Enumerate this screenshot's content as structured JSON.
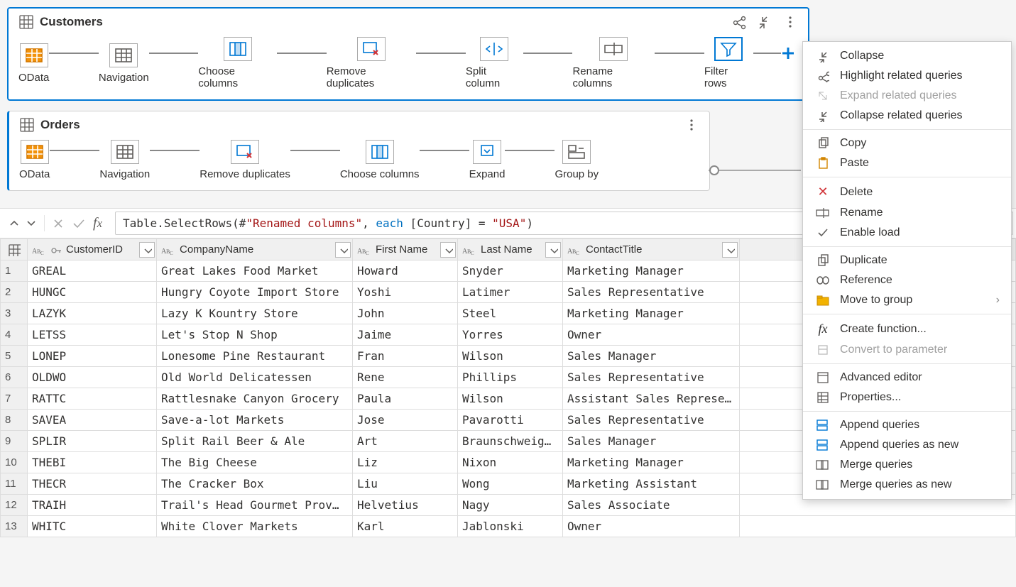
{
  "customers_query": {
    "title": "Customers",
    "steps": [
      "OData",
      "Navigation",
      "Choose columns",
      "Remove duplicates",
      "Split column",
      "Rename columns",
      "Filter rows"
    ]
  },
  "orders_query": {
    "title": "Orders",
    "steps": [
      "OData",
      "Navigation",
      "Remove duplicates",
      "Choose columns",
      "Expand",
      "Group by"
    ]
  },
  "formula": {
    "prefix": "Table.SelectRows(#",
    "step_ref": "\"Renamed columns\"",
    "mid": ", ",
    "each_kw": "each",
    "field": " [Country] = ",
    "value": "\"USA\"",
    "suffix": ")"
  },
  "columns": [
    "CustomerID",
    "CompanyName",
    "First Name",
    "Last Name",
    "ContactTitle"
  ],
  "rows": [
    {
      "n": "1",
      "id": "GREAL",
      "co": "Great Lakes Food Market",
      "fn": "Howard",
      "ln": "Snyder",
      "ti": "Marketing Manager"
    },
    {
      "n": "2",
      "id": "HUNGC",
      "co": "Hungry Coyote Import Store",
      "fn": "Yoshi",
      "ln": "Latimer",
      "ti": "Sales Representative"
    },
    {
      "n": "3",
      "id": "LAZYK",
      "co": "Lazy K Kountry Store",
      "fn": "John",
      "ln": "Steel",
      "ti": "Marketing Manager"
    },
    {
      "n": "4",
      "id": "LETSS",
      "co": "Let's Stop N Shop",
      "fn": "Jaime",
      "ln": "Yorres",
      "ti": "Owner"
    },
    {
      "n": "5",
      "id": "LONEP",
      "co": "Lonesome Pine Restaurant",
      "fn": "Fran",
      "ln": "Wilson",
      "ti": "Sales Manager"
    },
    {
      "n": "6",
      "id": "OLDWO",
      "co": "Old World Delicatessen",
      "fn": "Rene",
      "ln": "Phillips",
      "ti": "Sales Representative"
    },
    {
      "n": "7",
      "id": "RATTC",
      "co": "Rattlesnake Canyon Grocery",
      "fn": "Paula",
      "ln": "Wilson",
      "ti": "Assistant Sales Represe…"
    },
    {
      "n": "8",
      "id": "SAVEA",
      "co": "Save-a-lot Markets",
      "fn": "Jose",
      "ln": "Pavarotti",
      "ti": "Sales Representative"
    },
    {
      "n": "9",
      "id": "SPLIR",
      "co": "Split Rail Beer & Ale",
      "fn": "Art",
      "ln": "Braunschweig…",
      "ti": "Sales Manager"
    },
    {
      "n": "10",
      "id": "THEBI",
      "co": "The Big Cheese",
      "fn": "Liz",
      "ln": "Nixon",
      "ti": "Marketing Manager"
    },
    {
      "n": "11",
      "id": "THECR",
      "co": "The Cracker Box",
      "fn": "Liu",
      "ln": "Wong",
      "ti": "Marketing Assistant"
    },
    {
      "n": "12",
      "id": "TRAIH",
      "co": "Trail's Head Gourmet Prov…",
      "fn": "Helvetius",
      "ln": "Nagy",
      "ti": "Sales Associate"
    },
    {
      "n": "13",
      "id": "WHITC",
      "co": "White Clover Markets",
      "fn": "Karl",
      "ln": "Jablonski",
      "ti": "Owner"
    }
  ],
  "context_menu": {
    "collapse": "Collapse",
    "highlight_related": "Highlight related queries",
    "expand_related": "Expand related queries",
    "collapse_related": "Collapse related queries",
    "copy": "Copy",
    "paste": "Paste",
    "delete": "Delete",
    "rename": "Rename",
    "enable_load": "Enable load",
    "duplicate": "Duplicate",
    "reference": "Reference",
    "move_group": "Move to group",
    "create_fn": "Create function...",
    "convert_param": "Convert to parameter",
    "adv_editor": "Advanced editor",
    "properties": "Properties...",
    "append": "Append queries",
    "append_new": "Append queries as new",
    "merge": "Merge queries",
    "merge_new": "Merge queries as new"
  }
}
